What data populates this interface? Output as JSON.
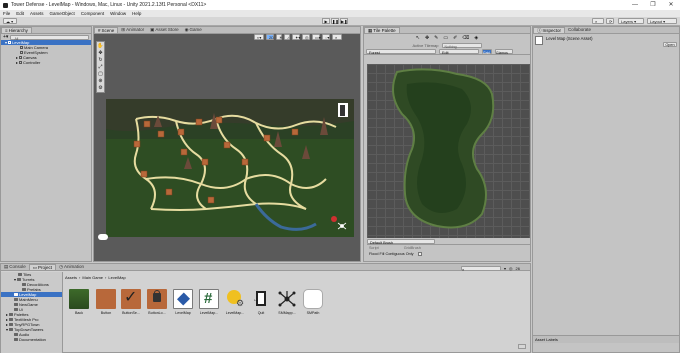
{
  "window": {
    "title": "Tower Defense - LevelMap - Windows, Mac, Linux - Unity 2021.2.13f1 Personal <DX11>",
    "controls": [
      "—",
      "❐",
      "✕"
    ]
  },
  "menu": [
    "File",
    "Edit",
    "Assets",
    "GameObject",
    "Component",
    "Window",
    "Help"
  ],
  "toolbar": {
    "layers": "Layers",
    "layout": "Layout"
  },
  "hierarchy": {
    "tab": "Hierarchy",
    "search_placeholder": "All",
    "items": [
      {
        "label": "LevelMap",
        "depth": 0,
        "selected": true
      },
      {
        "label": "Main Camera",
        "depth": 1
      },
      {
        "label": "EventSystem",
        "depth": 1
      },
      {
        "label": "Canvas",
        "depth": 1
      },
      {
        "label": "Controller",
        "depth": 1
      }
    ]
  },
  "scene": {
    "tabs": [
      "Scene",
      "Animator",
      "Asset Store",
      "Game"
    ],
    "active_tab": "Scene",
    "toggle_2d": "2D"
  },
  "tile_palette": {
    "tab": "Tile Palette",
    "active_tilemap_label": "Active Tilemap",
    "active_tilemap_value": "Nothing",
    "palette_name": "Forest",
    "edit_label": "Edit",
    "grid_label": "Grid",
    "gizmos_label": "Gizmos",
    "default_brush": "Default Brush",
    "script_label": "Script",
    "script_value": "GridBrush",
    "flood_fill": "Flood Fill Contiguous Only"
  },
  "inspector": {
    "tabs": [
      "Inspector",
      "Collaborate"
    ],
    "asset_title": "Level Map (Scene Asset)",
    "open_button": "Open",
    "asset_labels": "Asset Labels"
  },
  "project": {
    "tabs": [
      "Console",
      "Project",
      "Animation"
    ],
    "breadcrumb": [
      "Assets",
      "Main Game",
      "LevelMap"
    ],
    "count": "26",
    "folders": [
      {
        "label": "Tiles",
        "depth": 2
      },
      {
        "label": "Turrets",
        "depth": 2
      },
      {
        "label": "DecorAtions",
        "depth": 3
      },
      {
        "label": "Prefabs",
        "depth": 3
      },
      {
        "label": "LevelMap",
        "depth": 1,
        "selected": true
      },
      {
        "label": "MainMenu",
        "depth": 1
      },
      {
        "label": "NewGame",
        "depth": 1
      },
      {
        "label": "Ui",
        "depth": 1
      },
      {
        "label": "Palettes",
        "depth": 0
      },
      {
        "label": "TextMesh Pro",
        "depth": 0
      },
      {
        "label": "TinyRPGTown",
        "depth": 0
      },
      {
        "label": "TopDownTowers",
        "depth": 0
      },
      {
        "label": "Audio",
        "depth": 1
      },
      {
        "label": "Documentation",
        "depth": 1
      }
    ],
    "assets": [
      {
        "label": "Back",
        "icon": "grass-tile-icon"
      },
      {
        "label": "Button",
        "icon": "brown-square-icon"
      },
      {
        "label": "ButtonSe...",
        "icon": "checkmark-tile-icon"
      },
      {
        "label": "ButtonLo...",
        "icon": "lock-tile-icon"
      },
      {
        "label": "LevelMap",
        "icon": "unity-scene-icon"
      },
      {
        "label": "LevelMap...",
        "icon": "csharp-script-icon"
      },
      {
        "label": "LevelMap...",
        "icon": "scriptable-object-icon"
      },
      {
        "label": "Quit",
        "icon": "exit-door-icon"
      },
      {
        "label": "SMMapp...",
        "icon": "node-graph-icon"
      },
      {
        "label": "SMPath",
        "icon": "white-blob-icon"
      }
    ]
  },
  "colors": {
    "selection": "#3a72c4",
    "orange_tile": "#b8683a",
    "forest_dark": "#1e3a1a"
  }
}
